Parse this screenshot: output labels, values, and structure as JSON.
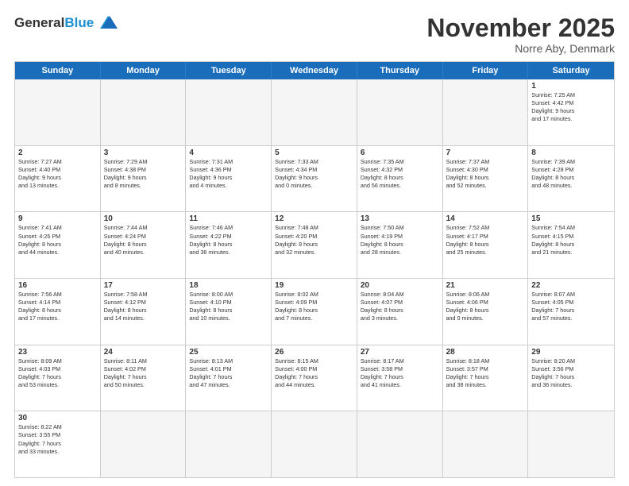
{
  "header": {
    "logo_general": "General",
    "logo_blue": "Blue",
    "month_title": "November 2025",
    "location": "Norre Aby, Denmark"
  },
  "weekdays": [
    "Sunday",
    "Monday",
    "Tuesday",
    "Wednesday",
    "Thursday",
    "Friday",
    "Saturday"
  ],
  "rows": [
    [
      {
        "day": "",
        "info": ""
      },
      {
        "day": "",
        "info": ""
      },
      {
        "day": "",
        "info": ""
      },
      {
        "day": "",
        "info": ""
      },
      {
        "day": "",
        "info": ""
      },
      {
        "day": "",
        "info": ""
      },
      {
        "day": "1",
        "info": "Sunrise: 7:25 AM\nSunset: 4:42 PM\nDaylight: 9 hours\nand 17 minutes."
      }
    ],
    [
      {
        "day": "2",
        "info": "Sunrise: 7:27 AM\nSunset: 4:40 PM\nDaylight: 9 hours\nand 13 minutes."
      },
      {
        "day": "3",
        "info": "Sunrise: 7:29 AM\nSunset: 4:38 PM\nDaylight: 9 hours\nand 8 minutes."
      },
      {
        "day": "4",
        "info": "Sunrise: 7:31 AM\nSunset: 4:36 PM\nDaylight: 9 hours\nand 4 minutes."
      },
      {
        "day": "5",
        "info": "Sunrise: 7:33 AM\nSunset: 4:34 PM\nDaylight: 9 hours\nand 0 minutes."
      },
      {
        "day": "6",
        "info": "Sunrise: 7:35 AM\nSunset: 4:32 PM\nDaylight: 8 hours\nand 56 minutes."
      },
      {
        "day": "7",
        "info": "Sunrise: 7:37 AM\nSunset: 4:30 PM\nDaylight: 8 hours\nand 52 minutes."
      },
      {
        "day": "8",
        "info": "Sunrise: 7:39 AM\nSunset: 4:28 PM\nDaylight: 8 hours\nand 48 minutes."
      }
    ],
    [
      {
        "day": "9",
        "info": "Sunrise: 7:41 AM\nSunset: 4:26 PM\nDaylight: 8 hours\nand 44 minutes."
      },
      {
        "day": "10",
        "info": "Sunrise: 7:44 AM\nSunset: 4:24 PM\nDaylight: 8 hours\nand 40 minutes."
      },
      {
        "day": "11",
        "info": "Sunrise: 7:46 AM\nSunset: 4:22 PM\nDaylight: 8 hours\nand 36 minutes."
      },
      {
        "day": "12",
        "info": "Sunrise: 7:48 AM\nSunset: 4:20 PM\nDaylight: 8 hours\nand 32 minutes."
      },
      {
        "day": "13",
        "info": "Sunrise: 7:50 AM\nSunset: 4:19 PM\nDaylight: 8 hours\nand 28 minutes."
      },
      {
        "day": "14",
        "info": "Sunrise: 7:52 AM\nSunset: 4:17 PM\nDaylight: 8 hours\nand 25 minutes."
      },
      {
        "day": "15",
        "info": "Sunrise: 7:54 AM\nSunset: 4:15 PM\nDaylight: 8 hours\nand 21 minutes."
      }
    ],
    [
      {
        "day": "16",
        "info": "Sunrise: 7:56 AM\nSunset: 4:14 PM\nDaylight: 8 hours\nand 17 minutes."
      },
      {
        "day": "17",
        "info": "Sunrise: 7:58 AM\nSunset: 4:12 PM\nDaylight: 8 hours\nand 14 minutes."
      },
      {
        "day": "18",
        "info": "Sunrise: 8:00 AM\nSunset: 4:10 PM\nDaylight: 8 hours\nand 10 minutes."
      },
      {
        "day": "19",
        "info": "Sunrise: 8:02 AM\nSunset: 4:09 PM\nDaylight: 8 hours\nand 7 minutes."
      },
      {
        "day": "20",
        "info": "Sunrise: 8:04 AM\nSunset: 4:07 PM\nDaylight: 8 hours\nand 3 minutes."
      },
      {
        "day": "21",
        "info": "Sunrise: 8:06 AM\nSunset: 4:06 PM\nDaylight: 8 hours\nand 0 minutes."
      },
      {
        "day": "22",
        "info": "Sunrise: 8:07 AM\nSunset: 4:05 PM\nDaylight: 7 hours\nand 57 minutes."
      }
    ],
    [
      {
        "day": "23",
        "info": "Sunrise: 8:09 AM\nSunset: 4:03 PM\nDaylight: 7 hours\nand 53 minutes."
      },
      {
        "day": "24",
        "info": "Sunrise: 8:11 AM\nSunset: 4:02 PM\nDaylight: 7 hours\nand 50 minutes."
      },
      {
        "day": "25",
        "info": "Sunrise: 8:13 AM\nSunset: 4:01 PM\nDaylight: 7 hours\nand 47 minutes."
      },
      {
        "day": "26",
        "info": "Sunrise: 8:15 AM\nSunset: 4:00 PM\nDaylight: 7 hours\nand 44 minutes."
      },
      {
        "day": "27",
        "info": "Sunrise: 8:17 AM\nSunset: 3:58 PM\nDaylight: 7 hours\nand 41 minutes."
      },
      {
        "day": "28",
        "info": "Sunrise: 8:18 AM\nSunset: 3:57 PM\nDaylight: 7 hours\nand 38 minutes."
      },
      {
        "day": "29",
        "info": "Sunrise: 8:20 AM\nSunset: 3:56 PM\nDaylight: 7 hours\nand 36 minutes."
      }
    ],
    [
      {
        "day": "30",
        "info": "Sunrise: 8:22 AM\nSunset: 3:55 PM\nDaylight: 7 hours\nand 33 minutes."
      },
      {
        "day": "",
        "info": ""
      },
      {
        "day": "",
        "info": ""
      },
      {
        "day": "",
        "info": ""
      },
      {
        "day": "",
        "info": ""
      },
      {
        "day": "",
        "info": ""
      },
      {
        "day": "",
        "info": ""
      }
    ]
  ]
}
